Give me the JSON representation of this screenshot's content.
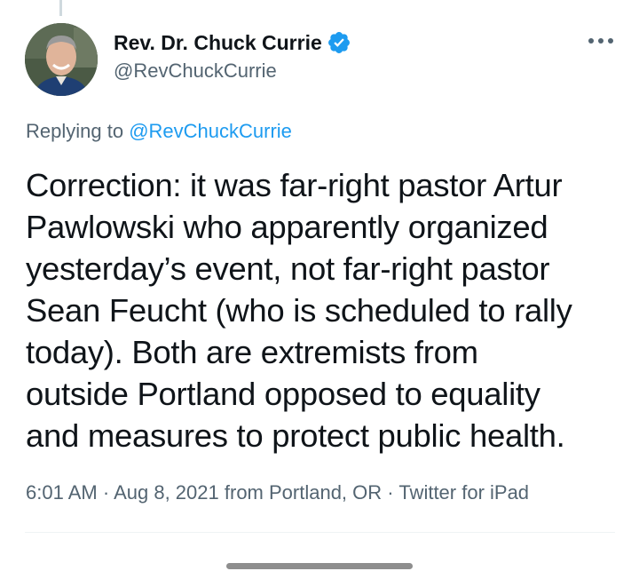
{
  "author": {
    "display_name": "Rev. Dr. Chuck Currie",
    "handle": "@RevChuckCurrie",
    "verified": true
  },
  "reply": {
    "prefix": "Replying to",
    "handle": "@RevChuckCurrie"
  },
  "tweet": {
    "lines": [
      "Correction: it was far-right pastor Artur",
      "Pawlowski who apparently organized",
      "yesterday’s event, not far-right pastor",
      "Sean Feucht (who is scheduled to rally",
      "today). Both are extremists from",
      "outside Portland opposed to equality",
      "and measures to protect public health."
    ]
  },
  "meta": {
    "time": "6:01 AM",
    "date": "Aug 8, 2021",
    "location": "from Portland, OR",
    "client": "Twitter for iPad",
    "separator": "·"
  },
  "colors": {
    "accent": "#1d9bf0",
    "secondary_text": "#536471",
    "primary_text": "#0f1419"
  },
  "icons": {
    "verified": "verified-badge-icon",
    "more": "more-options-icon"
  }
}
